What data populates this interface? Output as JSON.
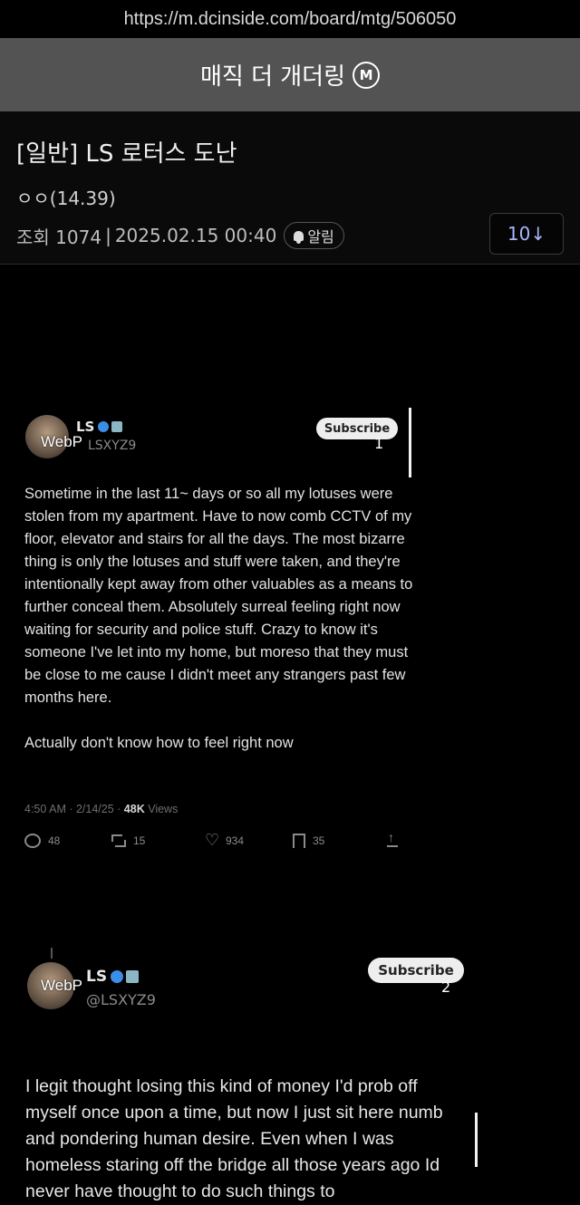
{
  "browser": {
    "url": "https://m.dcinside.com/board/mtg/506050"
  },
  "board": {
    "title": "매직 더 개더링",
    "badge": "M"
  },
  "post": {
    "title": "[일반] LS 로터스 도난",
    "author": "ㅇㅇ(14.39)",
    "views_label": "조회 1074",
    "separator": "|",
    "datetime": "2025.02.15 00:40",
    "alarm_label": "알림",
    "comment_button": "10↓"
  },
  "tweets": [
    {
      "overlay_label": "WebP",
      "counter": "1",
      "name": "LS",
      "handle": "LSXYZ9",
      "subscribe_label": "Subscribe",
      "paragraphs": [
        "Sometime in the last 11~ days or so all my lotuses were stolen from my apartment. Have to now comb CCTV of my floor, elevator and stairs for all the days. The most bizarre thing is only the lotuses and stuff were taken, and they're intentionally kept away from other valuables as a means to further conceal them. Absolutely surreal feeling right now waiting for security and police stuff. Crazy to know it's someone I've let into my home, but moreso that they must be close to me cause I didn't meet any strangers past few months here.",
        "Actually don't know how to feel right now"
      ],
      "timestamp": "4:50 AM · 2/14/25 · ",
      "views_count": "48K",
      "views_label": " Views",
      "stats": {
        "replies": "48",
        "retweets": "15",
        "likes": "934",
        "bookmarks": "35"
      }
    },
    {
      "overlay_label": "WebP",
      "counter": "2",
      "name": "LS",
      "handle": "@LSXYZ9",
      "subscribe_label": "Subscribe",
      "text": "I legit thought losing this kind of money I'd prob off myself once upon a time, but now I just sit here numb and pondering human desire. Even when I was homeless staring off the bridge all those years ago Id never have thought to do such things to"
    }
  ],
  "colors": {
    "header_bg": "#535353",
    "page_bg": "#000000",
    "comment_button_text": "#aab6ff",
    "verified": "#3b8ee8"
  }
}
